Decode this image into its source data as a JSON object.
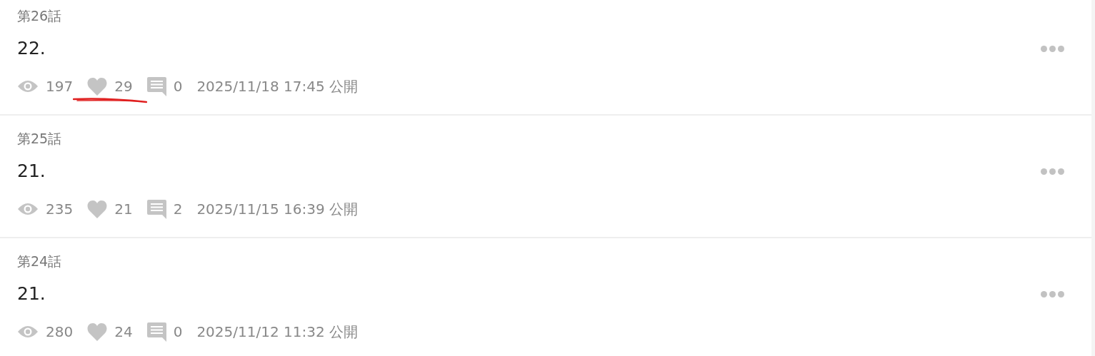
{
  "episodes": [
    {
      "episode": "第26話",
      "title": "22.",
      "views": "197",
      "likes": "29",
      "likes_underlined": true,
      "comments": "0",
      "published": "2025/11/18 17:45 公開"
    },
    {
      "episode": "第25話",
      "title": "21.",
      "views": "235",
      "likes": "21",
      "likes_underlined": false,
      "comments": "2",
      "published": "2025/11/15 16:39 公開"
    },
    {
      "episode": "第24話",
      "title": "21.",
      "views": "280",
      "likes": "24",
      "likes_underlined": false,
      "comments": "0",
      "published": "2025/11/12 11:32 公開"
    }
  ]
}
